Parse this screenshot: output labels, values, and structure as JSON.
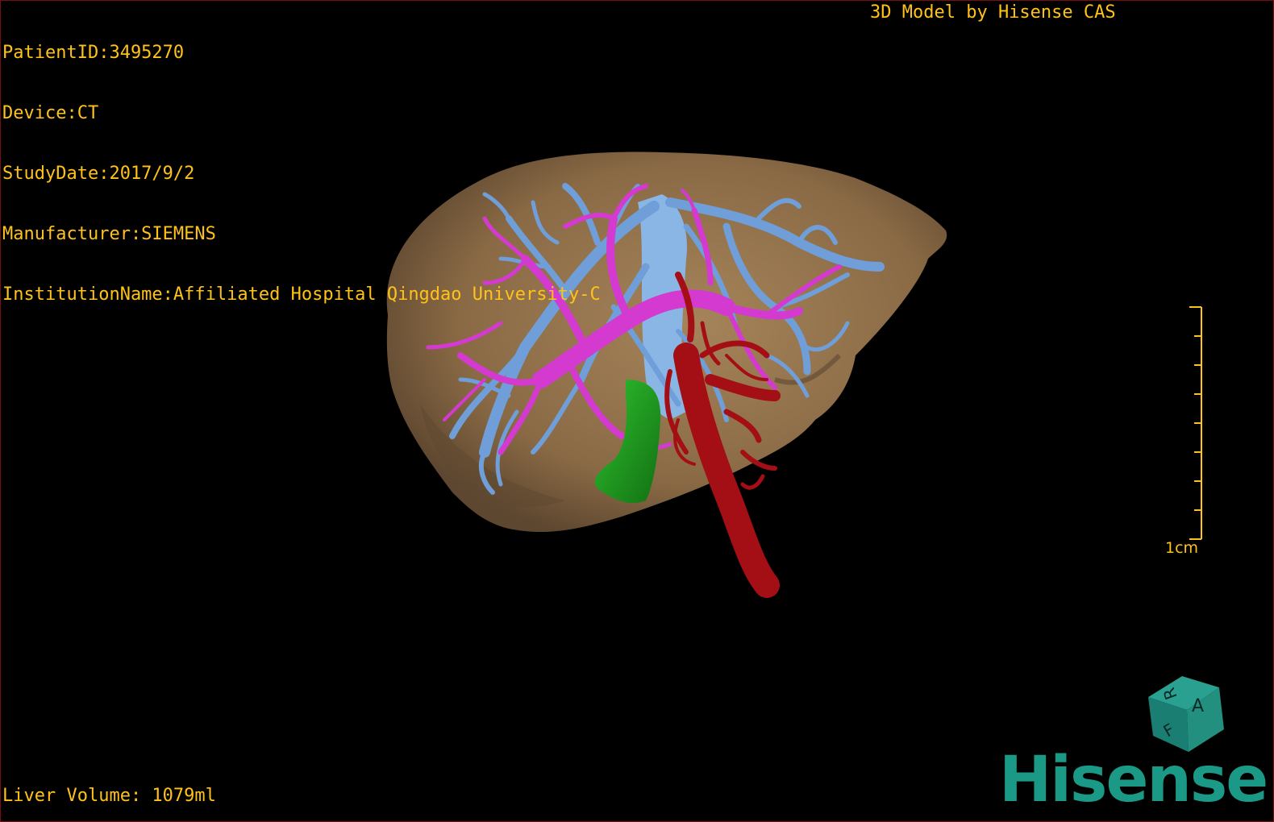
{
  "patient_info": {
    "patient_id": "PatientID:3495270",
    "device": "Device:CT",
    "study_date": "StudyDate:2017/9/2",
    "manufacturer": "Manufacturer:SIEMENS",
    "institution": "InstitutionName:Affiliated Hospital Qingdao University-C"
  },
  "title": "3D Model by Hisense CAS",
  "liver_volume": "Liver Volume: 1079ml",
  "scale": {
    "label": "1cm",
    "ticks": 9
  },
  "orientation_cube": {
    "faces": [
      "R",
      "A",
      "F"
    ]
  },
  "brand": "Hisense",
  "colors": {
    "text": "#ffc21a",
    "liver": "#8a6a45",
    "hepatic_vein": "#6f9ed8",
    "portal_vein": "#d43ad0",
    "artery_ivc": "#a30f14",
    "gallbladder": "#1f9a1f",
    "brand": "#1a9a86",
    "border": "#7a0f0f"
  },
  "model_structures": [
    "liver",
    "hepatic-veins",
    "portal-veins",
    "arteries",
    "gallbladder"
  ]
}
